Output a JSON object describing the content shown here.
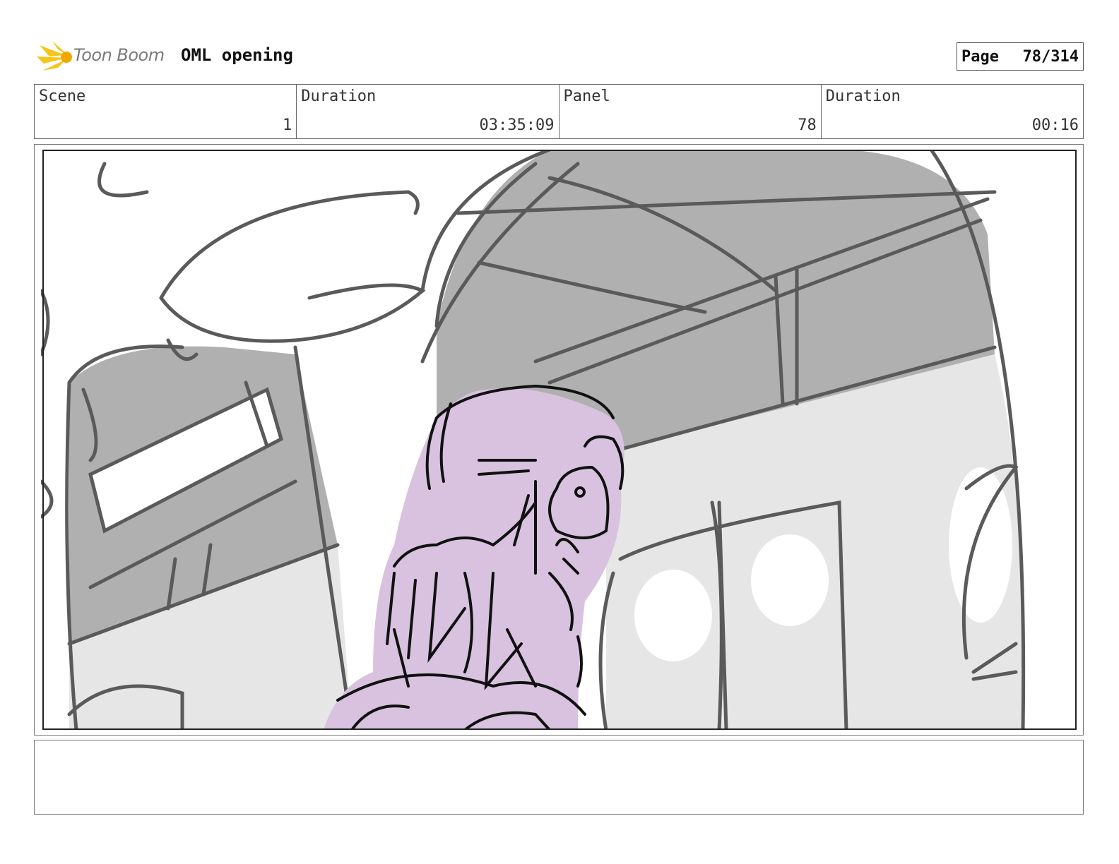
{
  "header": {
    "logo_text": "Toon Boom",
    "title": "OML opening",
    "page_label": "Page",
    "page_value": "78/314"
  },
  "info": {
    "scene_label": "Scene",
    "scene_value": "1",
    "duration_label": "Duration",
    "duration_value": "03:35:09",
    "panel_label": "Panel",
    "panel_value": "78",
    "panel_duration_label": "Duration",
    "panel_duration_value": "00:16"
  },
  "colors": {
    "character_fill": "#d9c2e0",
    "dark_gray": "#b0b0b0",
    "light_gray": "#e6e6e6",
    "line": "#5a5a5a",
    "logo_accent": "#f5c518"
  }
}
